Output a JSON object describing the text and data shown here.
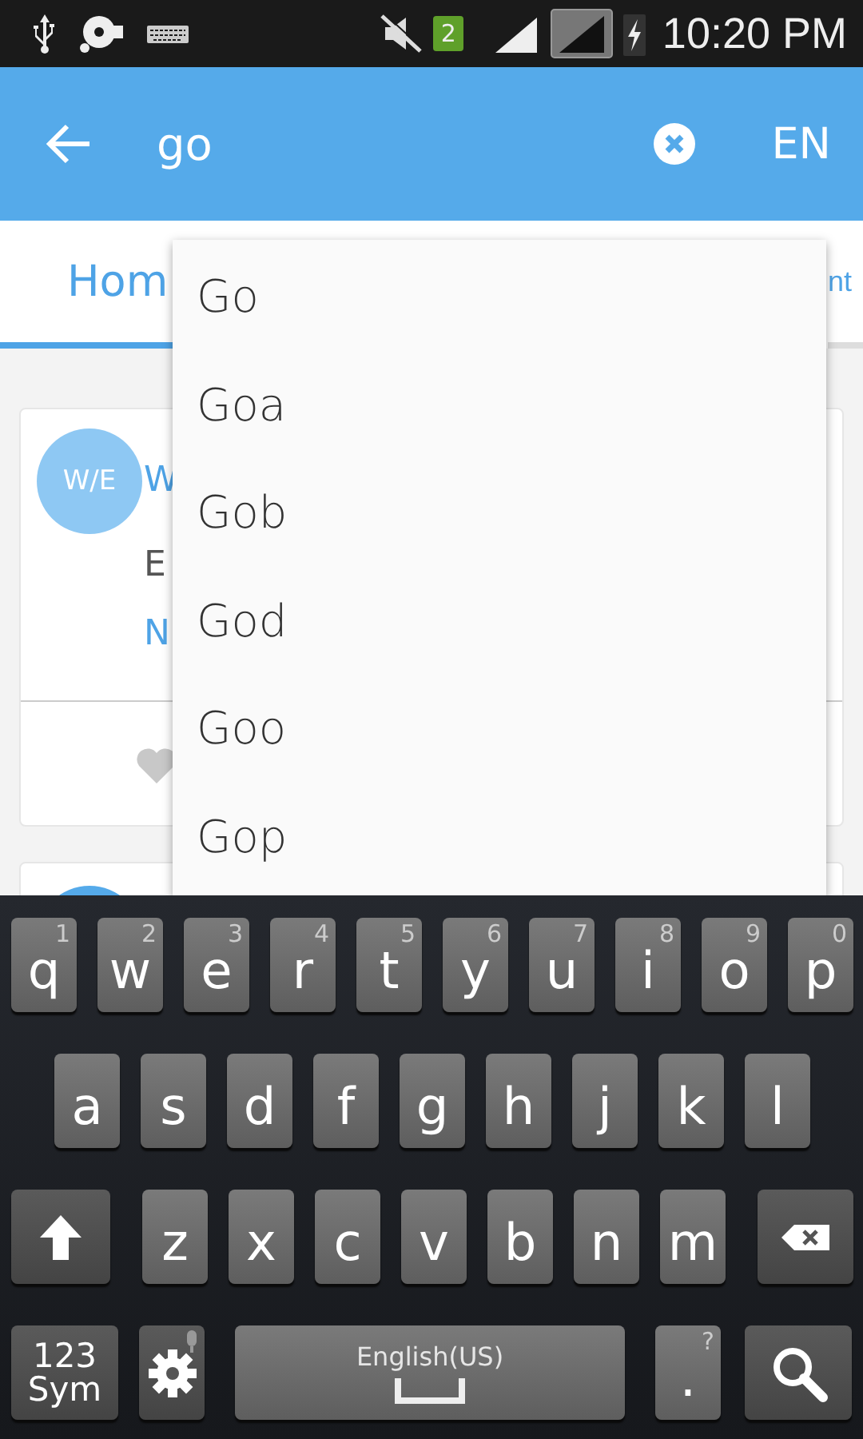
{
  "status_bar": {
    "sim_badge": "2",
    "time": "10:20 PM"
  },
  "search_bar": {
    "value": "go",
    "language": "EN"
  },
  "tabs": [
    {
      "label": "Hom",
      "selected": true
    },
    {
      "label": "nt",
      "selected": false
    }
  ],
  "cards": [
    {
      "avatar": "W/E",
      "title": "W",
      "subtitle": "E",
      "link": "N"
    }
  ],
  "suggestions": [
    "Go",
    "Goa",
    "Gob",
    "God",
    "Goo",
    "Gop"
  ],
  "keyboard": {
    "rows": [
      {
        "keys": [
          {
            "kind": "letter",
            "label": "q",
            "hint": "1"
          },
          {
            "kind": "letter",
            "label": "w",
            "hint": "2"
          },
          {
            "kind": "letter",
            "label": "e",
            "hint": "3"
          },
          {
            "kind": "letter",
            "label": "r",
            "hint": "4"
          },
          {
            "kind": "letter",
            "label": "t",
            "hint": "5"
          },
          {
            "kind": "letter",
            "label": "y",
            "hint": "6"
          },
          {
            "kind": "letter",
            "label": "u",
            "hint": "7"
          },
          {
            "kind": "letter",
            "label": "i",
            "hint": "8"
          },
          {
            "kind": "letter",
            "label": "o",
            "hint": "9"
          },
          {
            "kind": "letter",
            "label": "p",
            "hint": "0"
          }
        ]
      },
      {
        "keys": [
          {
            "kind": "letter",
            "label": "a"
          },
          {
            "kind": "letter",
            "label": "s"
          },
          {
            "kind": "letter",
            "label": "d"
          },
          {
            "kind": "letter",
            "label": "f"
          },
          {
            "kind": "letter",
            "label": "g"
          },
          {
            "kind": "letter",
            "label": "h"
          },
          {
            "kind": "letter",
            "label": "j"
          },
          {
            "kind": "letter",
            "label": "k"
          },
          {
            "kind": "letter",
            "label": "l"
          }
        ]
      },
      {
        "keys": [
          {
            "kind": "shift"
          },
          {
            "kind": "letter",
            "label": "z"
          },
          {
            "kind": "letter",
            "label": "x"
          },
          {
            "kind": "letter",
            "label": "c"
          },
          {
            "kind": "letter",
            "label": "v"
          },
          {
            "kind": "letter",
            "label": "b"
          },
          {
            "kind": "letter",
            "label": "n"
          },
          {
            "kind": "letter",
            "label": "m"
          },
          {
            "kind": "backspace"
          }
        ]
      },
      {
        "keys": [
          {
            "kind": "symbols",
            "label": "123 Sym"
          },
          {
            "kind": "settings"
          },
          {
            "kind": "space",
            "label": "English(US)"
          },
          {
            "kind": "period",
            "label": ".",
            "hint": "?"
          },
          {
            "kind": "search"
          }
        ]
      }
    ]
  }
}
